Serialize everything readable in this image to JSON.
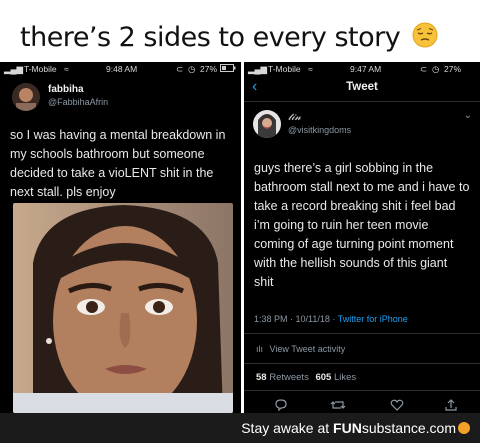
{
  "caption": "there’s 2 sides to every story",
  "left": {
    "carrier": "T-Mobile",
    "time": "9:48 AM",
    "battery": "27%",
    "name": "fabbiha",
    "handle": "@FabbihaAfrin",
    "tweet_lines": [
      "so I was having a mental breakdown in",
      "my schools bathroom but someone",
      "decided to take a vioLENT shit in the",
      "next stall. pls enjoy"
    ]
  },
  "right": {
    "carrier": "T-Mobile",
    "time": "9:47 AM",
    "battery": "27%",
    "header": "Tweet",
    "name": "𝓉𝒾𝓃",
    "handle": "@visitkingdoms",
    "tweet_lines": [
      "guys there’s a girl sobbing in the",
      "bathroom stall next to me and i have to",
      "take a record breaking shit i feel bad",
      "i’m going to ruin her teen movie",
      "coming of age turning point moment",
      "with the hellish sounds of this giant",
      "shit"
    ],
    "timestamp": "1:38 PM · 10/11/18 · ",
    "source": "Twitter for iPhone",
    "activity": "View Tweet activity",
    "retweets_count": "58",
    "retweets_label": "Retweets",
    "likes_count": "605",
    "likes_label": "Likes"
  },
  "footer": {
    "prefix": "Stay awake at ",
    "brand": "FUN",
    "brand_rest": "substance",
    "suffix": ".com"
  }
}
